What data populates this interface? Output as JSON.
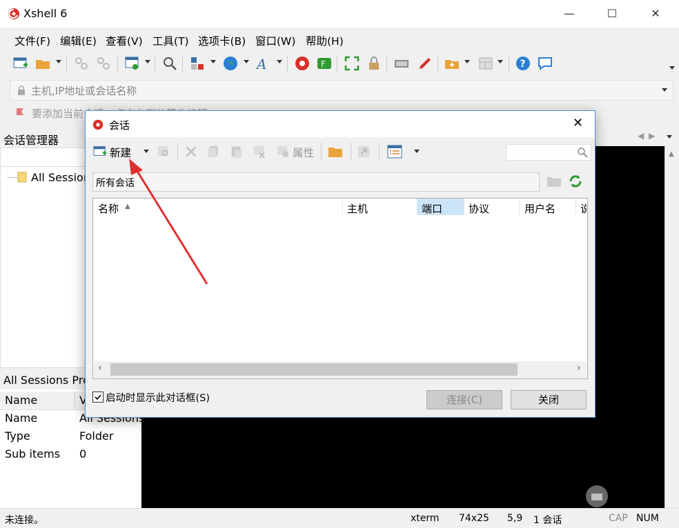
{
  "window": {
    "title": "Xshell 6",
    "minimize_glyph": "—",
    "maximize_glyph": "☐",
    "close_glyph": "✕"
  },
  "menu": [
    "文件(F)",
    "编辑(E)",
    "查看(V)",
    "工具(T)",
    "选项卡(B)",
    "窗口(W)",
    "帮助(H)"
  ],
  "address": {
    "placeholder": "主机,IP地址或会话名称"
  },
  "tip": {
    "text": "要添加当前会话，点击左侧的箭头按钮。"
  },
  "session_manager": {
    "title": "会话管理器",
    "tree_root": "All Sessions"
  },
  "properties": {
    "title": "All Sessions Properties",
    "col_name": "Name",
    "col_value": "Value",
    "rows": [
      {
        "name": "Name",
        "value": "All Sessions"
      },
      {
        "name": "Type",
        "value": "Folder"
      },
      {
        "name": "Sub items",
        "value": "0"
      }
    ]
  },
  "status": {
    "left": "未连接。",
    "term": "xterm",
    "size": "74x25",
    "pos": "5,9",
    "sessions": "1 会话",
    "cap": "CAP",
    "num": "NUM"
  },
  "dialog": {
    "title": "会话",
    "new_label": "新建",
    "properties_label": "属性",
    "path": "所有会话",
    "columns": [
      "名称",
      "主机",
      "端口",
      "协议",
      "用户名",
      "说明"
    ],
    "show_on_startup": "启动时显示此对话框(S)",
    "connect_label": "连接(C)",
    "close_label": "关闭"
  },
  "colors": {
    "accent": "#e03030",
    "highlight_column": "#cce4f7",
    "dialog_border": "#5a8fcf"
  }
}
